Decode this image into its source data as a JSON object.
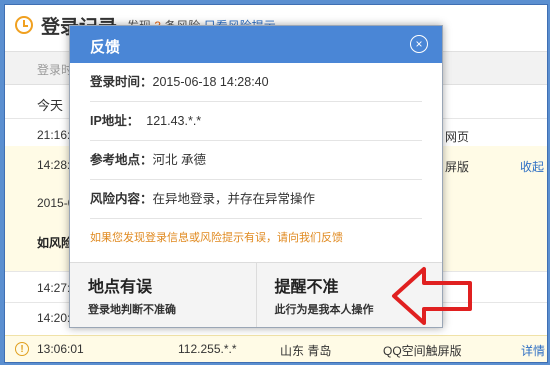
{
  "background": {
    "title": "登录记录",
    "subtitle_prefix": "发现",
    "subtitle_count": "3",
    "subtitle_suffix": "条风险",
    "subtitle_link": "只看风险提示",
    "header_col1": "登录时",
    "today_label": "今天",
    "rows": [
      {
        "time": "21:16:2",
        "right": "网页"
      },
      {
        "time": "14:27:1",
        "right": ""
      },
      {
        "time": "14:20:5",
        "right": ""
      }
    ],
    "yellow": {
      "time": "14:28:4",
      "client": "屏版",
      "action": "收起",
      "date": "2015-06",
      "risk_prefix": "如风险"
    },
    "bottom": {
      "warn_icon": "!",
      "time": "13:06:01",
      "ip": "112.255.*.*",
      "location": "山东 青岛",
      "client": "QQ空间触屏版",
      "action": "详情"
    }
  },
  "dialog": {
    "title": "反馈",
    "close_icon": "×",
    "fields": [
      {
        "label": "登录时间：",
        "value": "2015-06-18 14:28:40"
      },
      {
        "label": "IP地址：",
        "value": "121.43.*.*"
      },
      {
        "label": "参考地点：",
        "value": "河北 承德"
      },
      {
        "label": "风险内容：",
        "value": "在异地登录，并存在异常操作"
      }
    ],
    "note": "如果您发现登录信息或风险提示有误，请向我们反馈",
    "actions": [
      {
        "title": "地点有误",
        "desc": "登录地判断不准确"
      },
      {
        "title": "提醒不准",
        "desc": "此行为是我本人操作"
      }
    ]
  },
  "colors": {
    "header_blue": "#4a86d6",
    "arrow_red": "#e02020",
    "highlight_yellow": "#fffbe6"
  }
}
